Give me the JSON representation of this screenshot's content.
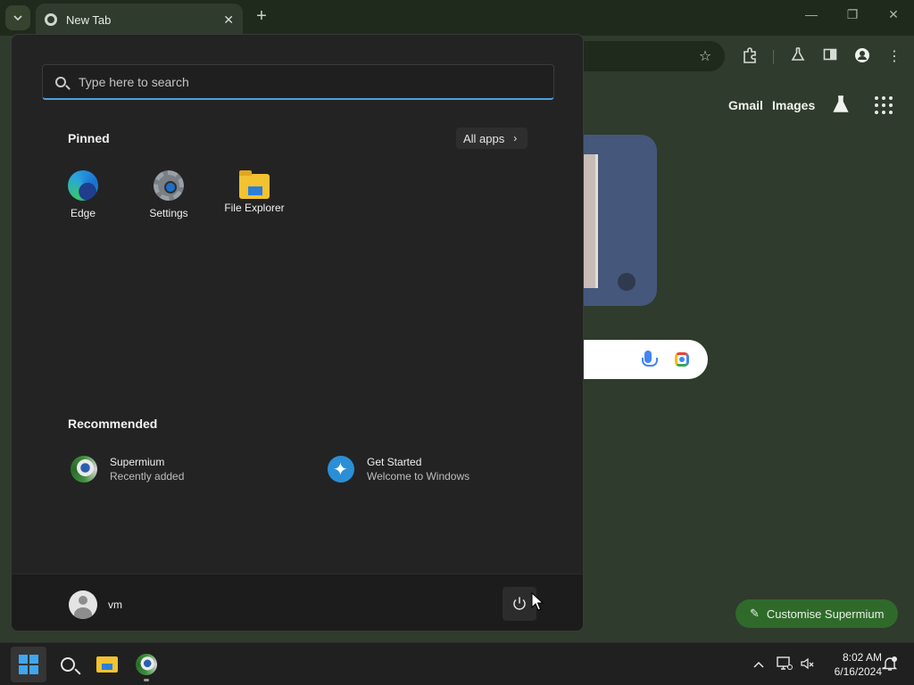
{
  "browser": {
    "tab": {
      "title": "New Tab"
    },
    "window": {
      "minimize": "—",
      "restore": "❐",
      "close": "✕"
    },
    "header_links": {
      "gmail": "Gmail",
      "images": "Images"
    },
    "customise_label": "Customise Supermium"
  },
  "start_menu": {
    "search": {
      "placeholder": "Type here to search"
    },
    "pinned": {
      "title": "Pinned",
      "all_apps_label": "All apps",
      "items": [
        {
          "label": "Edge",
          "icon": "edge-icon"
        },
        {
          "label": "Settings",
          "icon": "settings-icon"
        },
        {
          "label": "File Explorer",
          "icon": "file-explorer-icon"
        }
      ]
    },
    "recommended": {
      "title": "Recommended",
      "items": [
        {
          "title": "Supermium",
          "subtitle": "Recently added",
          "icon": "supermium-icon"
        },
        {
          "title": "Get Started",
          "subtitle": "Welcome to Windows",
          "icon": "get-started-icon"
        }
      ]
    },
    "user": {
      "name": "vm"
    }
  },
  "taskbar": {
    "time": "8:02 AM",
    "date": "6/16/2024"
  },
  "colors": {
    "accent_blue": "#4ca0e0",
    "browser_bg": "#2f3b2c",
    "start_bg": "#232323",
    "customise_green": "#2f6a2b"
  }
}
